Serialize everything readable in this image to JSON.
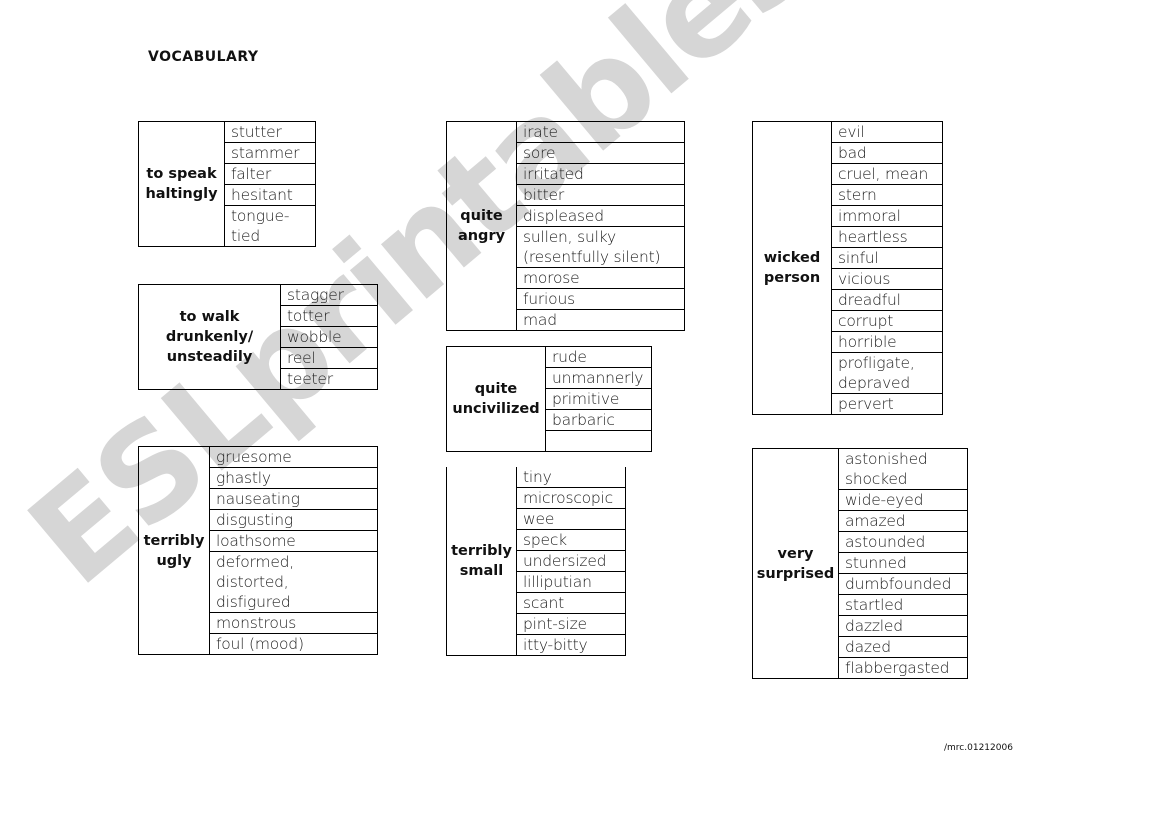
{
  "title": "VOCABULARY",
  "footer": "/mrc.01212006",
  "watermark": "ESLprintables.com",
  "tables": [
    {
      "heading": "to speak\nhaltingly",
      "words": [
        "stutter",
        "stammer",
        "falter",
        "hesitant",
        "tongue-\ntied"
      ]
    },
    {
      "heading": "to walk\ndrunkenly/\nunsteadily",
      "words": [
        "stagger",
        "totter",
        "wobble",
        "reel",
        "teeter"
      ]
    },
    {
      "heading": "terribly\nugly",
      "words": [
        "gruesome",
        "ghastly",
        "nauseating",
        "disgusting",
        "loathsome",
        "deformed,\ndistorted,\ndisfigured",
        "monstrous",
        "foul (mood)"
      ]
    },
    {
      "heading": "quite\nangry",
      "words": [
        "irate",
        "sore",
        "irritated",
        "bitter",
        "displeased",
        "sullen, sulky\n(resentfully silent)",
        "morose",
        "furious",
        "mad"
      ]
    },
    {
      "heading": "quite\nuncivilized",
      "words": [
        "rude",
        "unmannerly",
        "primitive",
        "barbaric",
        ""
      ]
    },
    {
      "heading": "terribly\nsmall",
      "words": [
        "tiny",
        "microscopic",
        "wee",
        "speck",
        "undersized",
        "lilliputian",
        "scant",
        "pint-size",
        "itty-bitty"
      ]
    },
    {
      "heading": "wicked\nperson",
      "words": [
        "evil",
        "bad",
        "cruel, mean",
        "stern",
        "immoral",
        "heartless",
        "sinful",
        "vicious",
        "dreadful",
        "corrupt",
        "horrible",
        "profligate,\ndepraved",
        "pervert"
      ]
    },
    {
      "heading": "very\nsurprised",
      "words": [
        "astonished\nshocked",
        "wide-eyed",
        "amazed",
        "astounded",
        "stunned",
        "dumbfounded",
        "startled",
        "dazzled",
        "dazed",
        "flabbergasted"
      ]
    }
  ]
}
